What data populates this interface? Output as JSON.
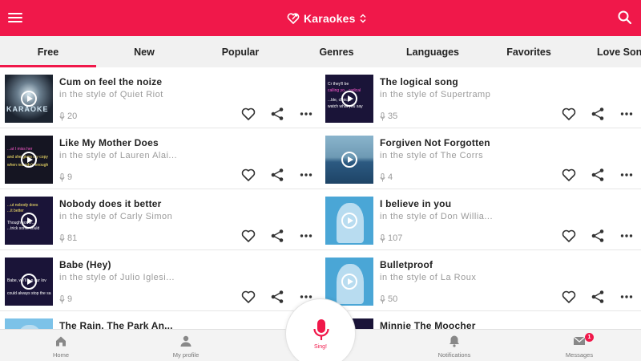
{
  "colors": {
    "accent": "#f0184a",
    "muted_text": "#9a9a9a",
    "tab_bg": "#f1f1f1"
  },
  "header": {
    "title": "Karaokes",
    "logo_icon": "heart-microphone-icon",
    "menu_icon": "hamburger-menu-icon",
    "search_icon": "search-icon",
    "dropdown_icon": "up-down-arrows-icon"
  },
  "tabs": [
    {
      "label": "Free",
      "active": true
    },
    {
      "label": "New"
    },
    {
      "label": "Popular"
    },
    {
      "label": "Genres"
    },
    {
      "label": "Languages"
    },
    {
      "label": "Favorites"
    },
    {
      "label": "Love Son"
    }
  ],
  "songs": [
    {
      "title": "Cum on feel the noize",
      "artist": "in the style of Quiet Riot",
      "count": "20"
    },
    {
      "title": "The logical song",
      "artist": "in the style of Supertramp",
      "count": "35"
    },
    {
      "title": "Like My Mother Does",
      "artist": "in the style of Lauren Alai...",
      "count": "9"
    },
    {
      "title": "Forgiven Not Forgotten",
      "artist": "in the style of The Corrs",
      "count": "4"
    },
    {
      "title": "Nobody does it better",
      "artist": "in the style of Carly Simon",
      "count": "81"
    },
    {
      "title": "I believe in you",
      "artist": "in the style of Don Willia...",
      "count": "107"
    },
    {
      "title": "Babe (Hey)",
      "artist": "in the style of Julio Iglesi...",
      "count": "9"
    },
    {
      "title": "Bulletproof",
      "artist": "in the style of La Roux",
      "count": "50"
    },
    {
      "title": "The Rain, The Park An...",
      "artist": "",
      "count": ""
    },
    {
      "title": "Minnie The Moocher",
      "artist": "",
      "count": ""
    }
  ],
  "thumb_text": {
    "karaoke": "KARAOKE",
    "logical": [
      "Cr they'll be",
      "calling yo... radical",
      "...ble, clinical",
      "watch what you say"
    ],
    "mother": [
      "...at I miss her",
      "and she gives my copy",
      "when nobody's enough"
    ],
    "nobody": [
      "...ut nobody does",
      "...it better",
      "Though some...",
      "...trick some could"
    ],
    "babe": [
      "Babe, we'll ...n our lov",
      "could always stop the sa"
    ]
  },
  "bottom_nav": {
    "home": "Home",
    "profile": "My profile",
    "sing": "Sing!",
    "notifications": "Notifications",
    "messages": "Messages",
    "messages_badge": "1"
  }
}
